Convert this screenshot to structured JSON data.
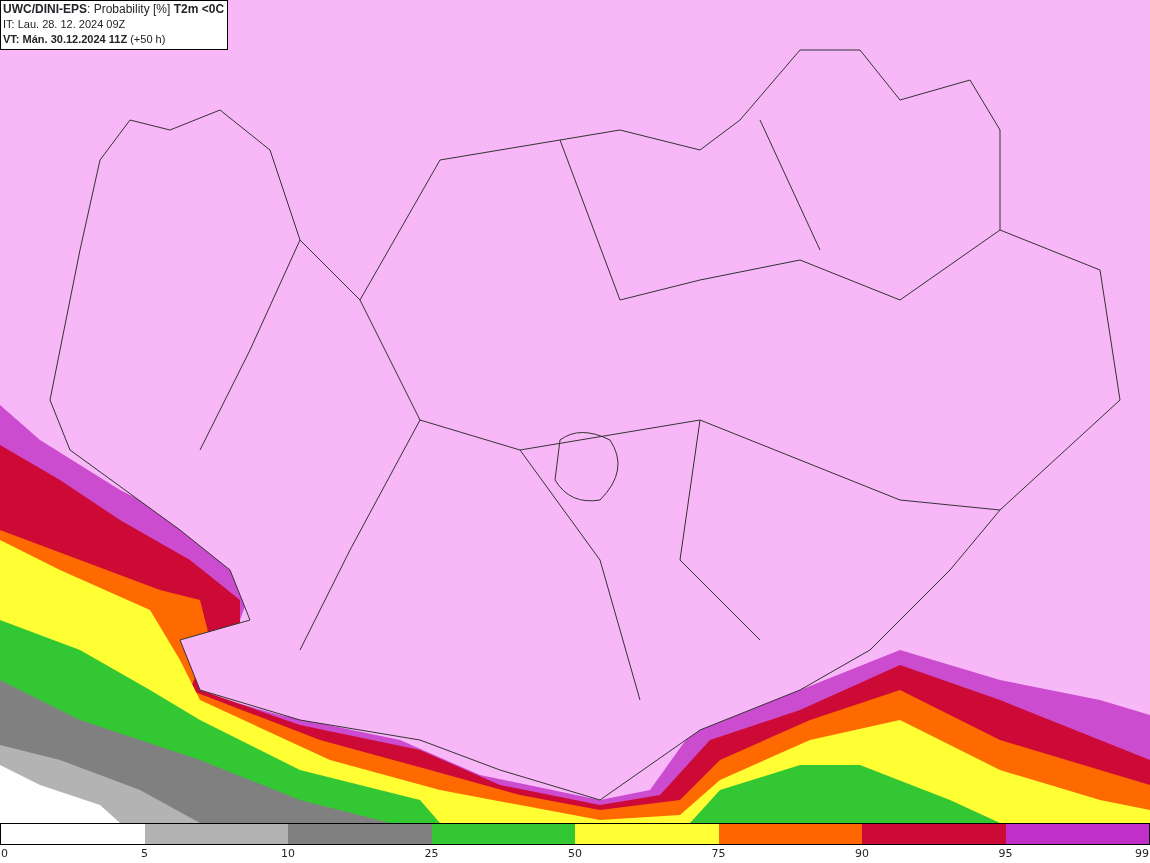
{
  "header": {
    "lines": [
      "**UWC/DINI-EPS**: Probability [%] **T2m <0C**",
      "IT: Lau. 28. 12. 2024 09Z",
      "**VT: Mán. 30.12.2024 11Z** (+50 h)"
    ]
  },
  "legend": {
    "segments": [
      {
        "label": "0",
        "color": "#ffffff"
      },
      {
        "label": "5",
        "color": "#b3b3b3"
      },
      {
        "label": "10",
        "color": "#808080"
      },
      {
        "label": "25",
        "color": "#33c833"
      },
      {
        "label": "50",
        "color": "#ffff33"
      },
      {
        "label": "75",
        "color": "#ff6600"
      },
      {
        "label": "90",
        "color": "#cc0a35"
      },
      {
        "label": "95",
        "color": "#c030c8"
      }
    ],
    "end_label": "99"
  }
}
